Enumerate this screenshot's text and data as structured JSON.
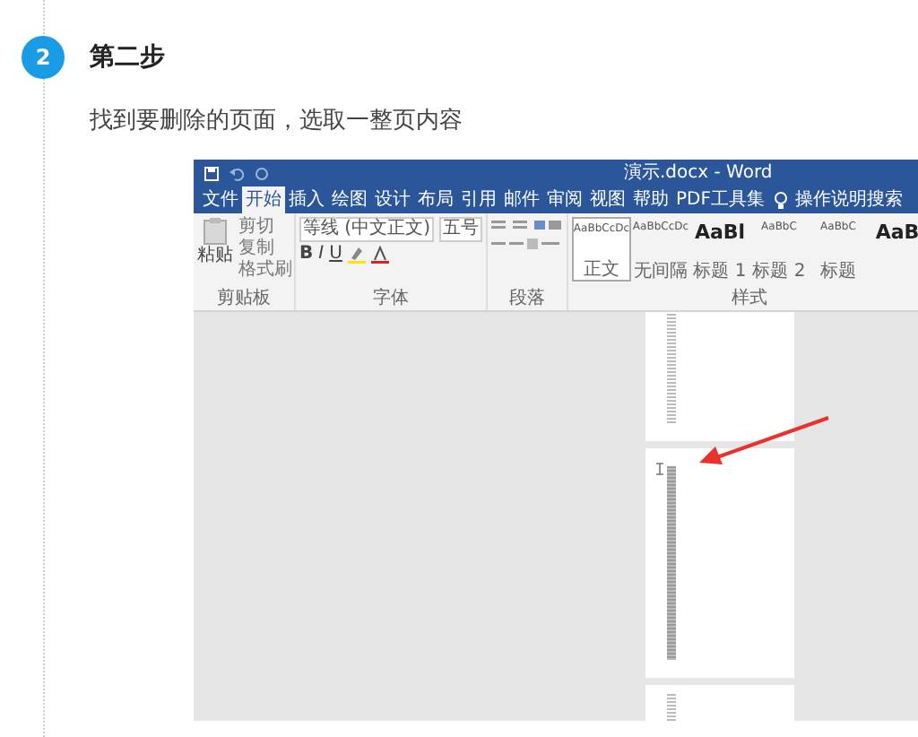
{
  "step": {
    "number": "2",
    "title": "第二步",
    "description": "找到要删除的页面，选取一整页内容"
  },
  "screenshot": {
    "window_title": "演示.docx - Word",
    "tabs": [
      {
        "label": "文件",
        "selected": false
      },
      {
        "label": "开始",
        "selected": true
      },
      {
        "label": "插入",
        "selected": false
      },
      {
        "label": "绘图",
        "selected": false
      },
      {
        "label": "设计",
        "selected": false
      },
      {
        "label": "布局",
        "selected": false
      },
      {
        "label": "引用",
        "selected": false
      },
      {
        "label": "邮件",
        "selected": false
      },
      {
        "label": "审阅",
        "selected": false
      },
      {
        "label": "视图",
        "selected": false
      },
      {
        "label": "帮助",
        "selected": false
      },
      {
        "label": "PDF工具集",
        "selected": false
      }
    ],
    "tell_me": "操作说明搜索",
    "clipboard": {
      "paste": "粘贴",
      "actions": [
        "剪切",
        "复制",
        "格式刷"
      ],
      "label": "剪贴板"
    },
    "font": {
      "name": "等线 (中文正文)",
      "size": "五号",
      "buttons": [
        "B",
        "I",
        "U"
      ],
      "label": "字体"
    },
    "paragraph": {
      "label": "段落"
    },
    "styles": {
      "items": [
        {
          "sample": "AaBbCcDc",
          "name": "正文",
          "selected": true
        },
        {
          "sample": "AaBbCcDc",
          "name": "无间隔",
          "selected": false
        },
        {
          "sample": "AaBl",
          "name": "标题 1",
          "selected": false
        },
        {
          "sample": "AaBbC",
          "name": "标题 2",
          "selected": false
        },
        {
          "sample": "AaBbC",
          "name": "标题",
          "selected": false
        },
        {
          "sample": "AaB",
          "selected": false
        }
      ],
      "label": "样式"
    },
    "pages": [
      {
        "selected": false
      },
      {
        "selected": true
      },
      {
        "selected": false
      }
    ]
  }
}
